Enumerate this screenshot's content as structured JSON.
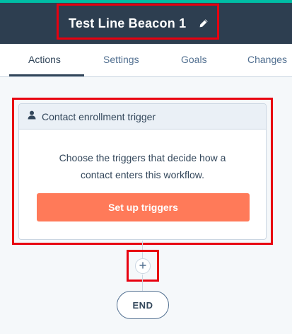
{
  "header": {
    "title": "Test Line Beacon 1",
    "edit_icon": "pencil-icon",
    "background_color": "#2d3e50",
    "accent_color": "#00bda5"
  },
  "tabs": [
    {
      "label": "Actions",
      "active": true
    },
    {
      "label": "Settings",
      "active": false
    },
    {
      "label": "Goals",
      "active": false
    },
    {
      "label": "Changes",
      "active": false
    }
  ],
  "trigger_card": {
    "header_label": "Contact enrollment trigger",
    "header_icon": "contact-person-icon",
    "description_line1": "Choose the triggers that decide how a",
    "description_line2": "contact enters this workflow.",
    "button_label": "Set up triggers",
    "button_color": "#ff7a59"
  },
  "flow": {
    "add_action_icon": "plus-icon",
    "end_label": "END"
  },
  "highlight_color": "#e8000f"
}
